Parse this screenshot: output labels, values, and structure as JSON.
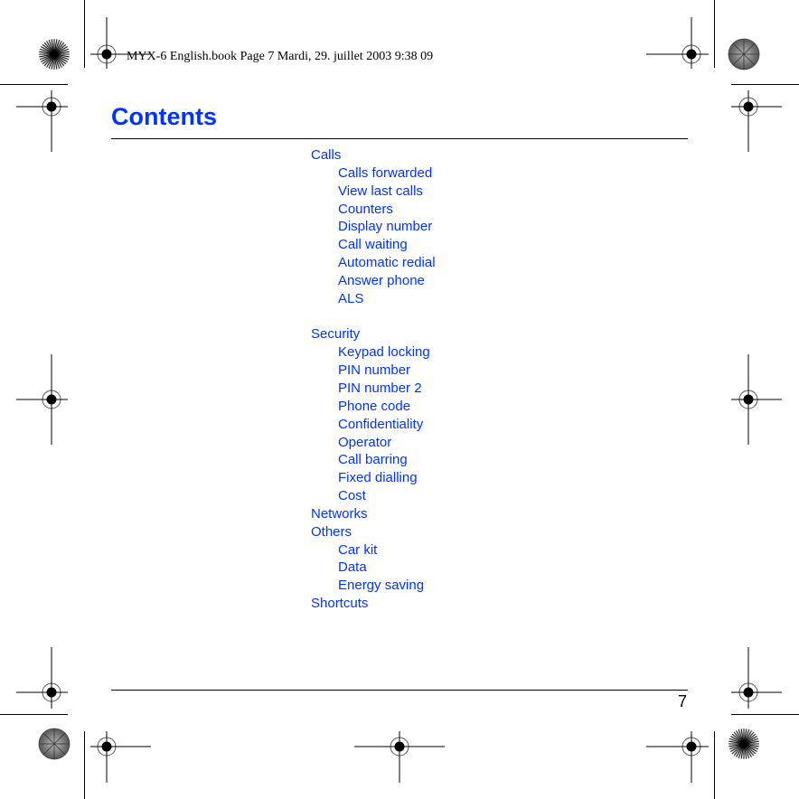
{
  "header": {
    "print_info": "MYX-6 English.book  Page 7  Mardi, 29. juillet 2003  9:38 09"
  },
  "title": "Contents",
  "page_number": "7",
  "colors": {
    "link": "#0033ff",
    "text": "#000000"
  },
  "toc": [
    {
      "label": "Calls",
      "level": 1
    },
    {
      "label": "Calls forwarded",
      "level": 2
    },
    {
      "label": "View last calls",
      "level": 2
    },
    {
      "label": "Counters",
      "level": 2
    },
    {
      "label": "Display number",
      "level": 2
    },
    {
      "label": "Call waiting",
      "level": 2
    },
    {
      "label": "Automatic redial",
      "level": 2
    },
    {
      "label": "Answer phone",
      "level": 2
    },
    {
      "label": "ALS",
      "level": 2
    },
    {
      "label": "",
      "level": 0
    },
    {
      "label": "Security",
      "level": 1
    },
    {
      "label": "Keypad locking",
      "level": 2
    },
    {
      "label": "PIN number",
      "level": 2
    },
    {
      "label": "PIN number 2",
      "level": 2
    },
    {
      "label": "Phone code",
      "level": 2
    },
    {
      "label": "Confidentiality",
      "level": 2
    },
    {
      "label": "Operator",
      "level": 2
    },
    {
      "label": "Call barring",
      "level": 2
    },
    {
      "label": "Fixed dialling",
      "level": 2
    },
    {
      "label": "Cost",
      "level": 2
    },
    {
      "label": "Networks",
      "level": 1
    },
    {
      "label": "Others",
      "level": 1
    },
    {
      "label": "Car kit",
      "level": 2
    },
    {
      "label": "Data",
      "level": 2
    },
    {
      "label": "Energy saving",
      "level": 2
    },
    {
      "label": "Shortcuts",
      "level": 1
    }
  ]
}
